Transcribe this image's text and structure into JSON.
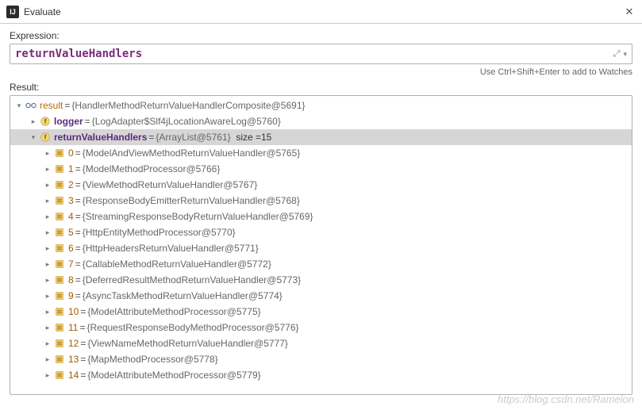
{
  "titlebar": {
    "title": "Evaluate"
  },
  "labels": {
    "expression": "Expression:",
    "result": "Result:"
  },
  "expression": {
    "value": "returnValueHandlers"
  },
  "hint": "Use Ctrl+Shift+Enter to add to Watches",
  "tree": {
    "root": {
      "name": "result",
      "value": "{HandlerMethodReturnValueHandlerComposite@5691}",
      "children": [
        {
          "name": "logger",
          "kind": "field",
          "value": "{LogAdapter$Slf4jLocationAwareLog@5760}",
          "expanded": false
        },
        {
          "name": "returnValueHandlers",
          "kind": "field",
          "value": "{ArrayList@5761}",
          "sizeLabel": "size = ",
          "size": "15",
          "selected": true,
          "expanded": true,
          "items": [
            {
              "idx": "0",
              "value": "{ModelAndViewMethodReturnValueHandler@5765}"
            },
            {
              "idx": "1",
              "value": "{ModelMethodProcessor@5766}"
            },
            {
              "idx": "2",
              "value": "{ViewMethodReturnValueHandler@5767}"
            },
            {
              "idx": "3",
              "value": "{ResponseBodyEmitterReturnValueHandler@5768}"
            },
            {
              "idx": "4",
              "value": "{StreamingResponseBodyReturnValueHandler@5769}"
            },
            {
              "idx": "5",
              "value": "{HttpEntityMethodProcessor@5770}"
            },
            {
              "idx": "6",
              "value": "{HttpHeadersReturnValueHandler@5771}"
            },
            {
              "idx": "7",
              "value": "{CallableMethodReturnValueHandler@5772}"
            },
            {
              "idx": "8",
              "value": "{DeferredResultMethodReturnValueHandler@5773}"
            },
            {
              "idx": "9",
              "value": "{AsyncTaskMethodReturnValueHandler@5774}"
            },
            {
              "idx": "10",
              "value": "{ModelAttributeMethodProcessor@5775}"
            },
            {
              "idx": "11",
              "value": "{RequestResponseBodyMethodProcessor@5776}"
            },
            {
              "idx": "12",
              "value": "{ViewNameMethodReturnValueHandler@5777}"
            },
            {
              "idx": "13",
              "value": "{MapMethodProcessor@5778}"
            },
            {
              "idx": "14",
              "value": "{ModelAttributeMethodProcessor@5779}"
            }
          ]
        }
      ]
    }
  },
  "watermark": "https://blog.csdn.net/Ramelon"
}
